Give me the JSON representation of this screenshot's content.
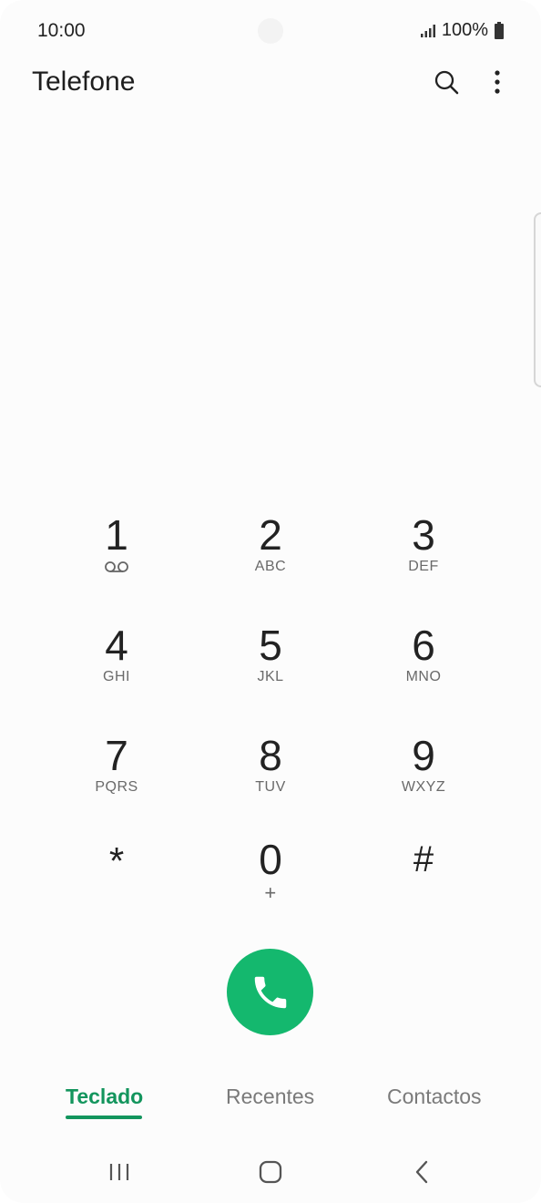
{
  "status_bar": {
    "time": "10:00",
    "battery": "100%"
  },
  "app_bar": {
    "title": "Telefone"
  },
  "keypad": {
    "keys": [
      {
        "digit": "1",
        "letters": "",
        "icon": "voicemail-icon"
      },
      {
        "digit": "2",
        "letters": "ABC"
      },
      {
        "digit": "3",
        "letters": "DEF"
      },
      {
        "digit": "4",
        "letters": "GHI"
      },
      {
        "digit": "5",
        "letters": "JKL"
      },
      {
        "digit": "6",
        "letters": "MNO"
      },
      {
        "digit": "7",
        "letters": "PQRS"
      },
      {
        "digit": "8",
        "letters": "TUV"
      },
      {
        "digit": "9",
        "letters": "WXYZ"
      },
      {
        "digit": "*",
        "letters": ""
      },
      {
        "digit": "0",
        "letters": "+"
      },
      {
        "digit": "#",
        "letters": ""
      }
    ]
  },
  "call_button": {
    "icon": "phone-icon",
    "color": "#14b86e"
  },
  "tabs": [
    {
      "label": "Teclado",
      "active": true
    },
    {
      "label": "Recentes",
      "active": false
    },
    {
      "label": "Contactos",
      "active": false
    }
  ],
  "colors": {
    "accent": "#13955d",
    "call": "#14b86e"
  }
}
